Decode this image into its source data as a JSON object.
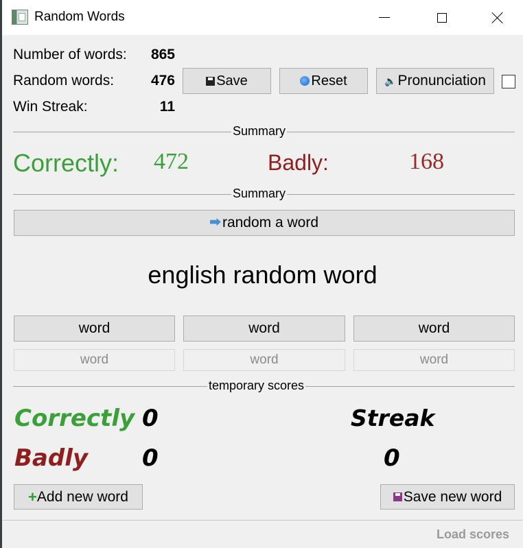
{
  "window": {
    "title": "Random Words"
  },
  "stats": {
    "number_of_words_label": "Number of words:",
    "number_of_words": "865",
    "random_words_label": "Random words:",
    "random_words": "476",
    "win_streak_label": "Win Streak:",
    "win_streak": "11"
  },
  "toolbar": {
    "save_label": "Save",
    "reset_label": "Reset",
    "pronunciation_label": "Pronunciation",
    "pronunciation_checked": false
  },
  "summary": {
    "section_label": "Summary",
    "correctly_label": "Correctly:",
    "correctly_value": "472",
    "badly_label": "Badly:",
    "badly_value": "168",
    "section2_label": "Summary"
  },
  "random_button_label": "random a word",
  "current_word": "english random word",
  "answers": [
    "word",
    "word",
    "word"
  ],
  "answer_inputs": [
    "word",
    "word",
    "word"
  ],
  "temporary_scores": {
    "section_label": "temporary scores",
    "correctly_label": "Correctly",
    "correctly_value": "0",
    "badly_label": "Badly",
    "badly_value": "0",
    "streak_label": "Streak",
    "streak_value": "0"
  },
  "buttons": {
    "add_new_word": "Add new word",
    "save_new_word": "Save new word"
  },
  "statusbar": {
    "load_scores": "Load scores"
  },
  "colors": {
    "correct": "#3aa03a",
    "bad": "#8f1e1e",
    "window_bg": "#f0f0f0"
  }
}
